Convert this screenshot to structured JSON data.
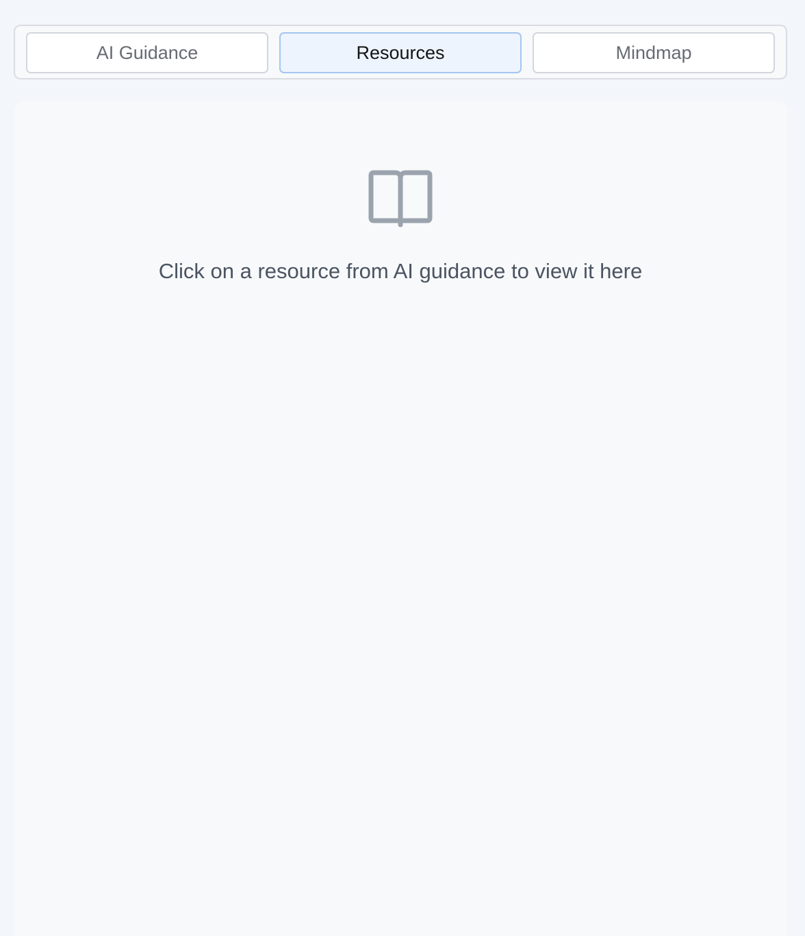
{
  "tabs": [
    {
      "label": "AI Guidance",
      "active": false
    },
    {
      "label": "Resources",
      "active": true
    },
    {
      "label": "Mindmap",
      "active": false
    }
  ],
  "empty_state": {
    "icon": "book-open-icon",
    "message": "Click on a resource from AI guidance to view it here"
  },
  "colors": {
    "active_tab_background": "#edf4fd",
    "active_tab_border": "#a4c6f0",
    "icon": "#9ba3ae",
    "message_text": "#4b5461"
  }
}
